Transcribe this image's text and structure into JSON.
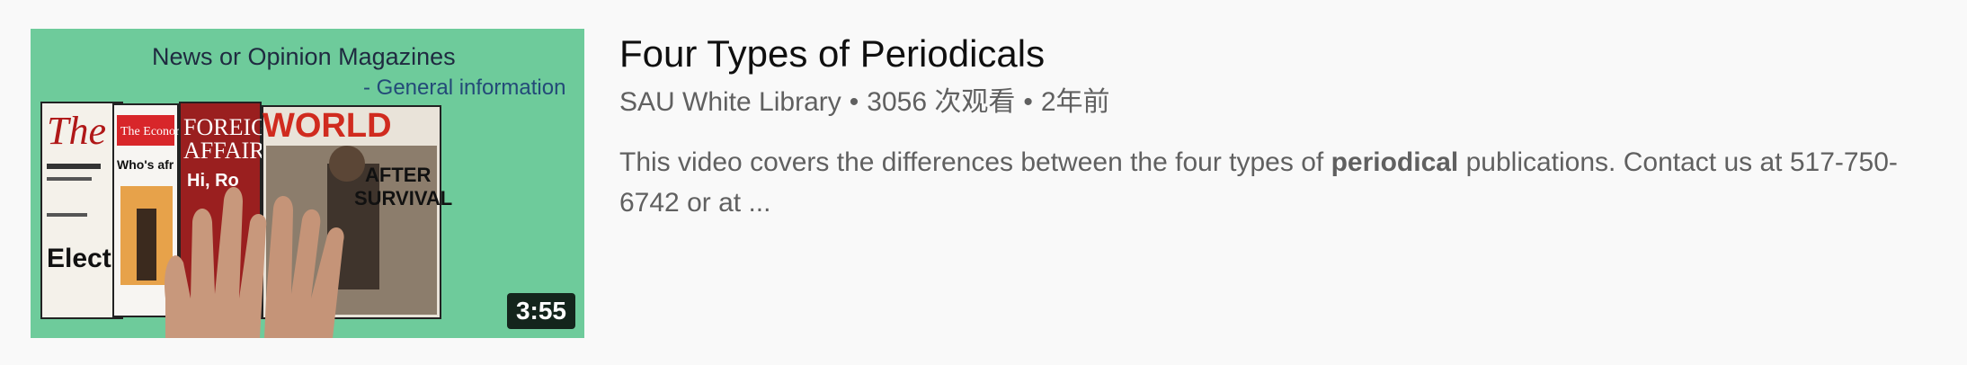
{
  "thumbnail": {
    "title_text": "News or Opinion Magazines",
    "subtitle_text": "- General information",
    "magazines": [
      "The Atlantic",
      "The Economist",
      "Foreign Affairs",
      "World"
    ],
    "cover_texts": {
      "atlantic": "The Atl",
      "atlantic_bottom": "Electi",
      "economist": "The Economist",
      "economist_caption": "Who's afr",
      "foreign_affairs": "FOREIG AFFAIR",
      "foreign_affairs_sub": "Hi, Ro",
      "world": "WORLD",
      "world_caption": "AFTER SURVIVAL"
    },
    "background_color": "#6ecb9b",
    "duration": "3:55"
  },
  "video": {
    "title": "Four Types of Periodicals",
    "channel": "SAU White Library",
    "separator": "•",
    "views": "3056 次观看",
    "age": "2年前",
    "description_before": "This video covers the differences between the four types of ",
    "description_highlight": "periodical",
    "description_after": " publications. Contact us at 517-750-6742 or at ..."
  }
}
